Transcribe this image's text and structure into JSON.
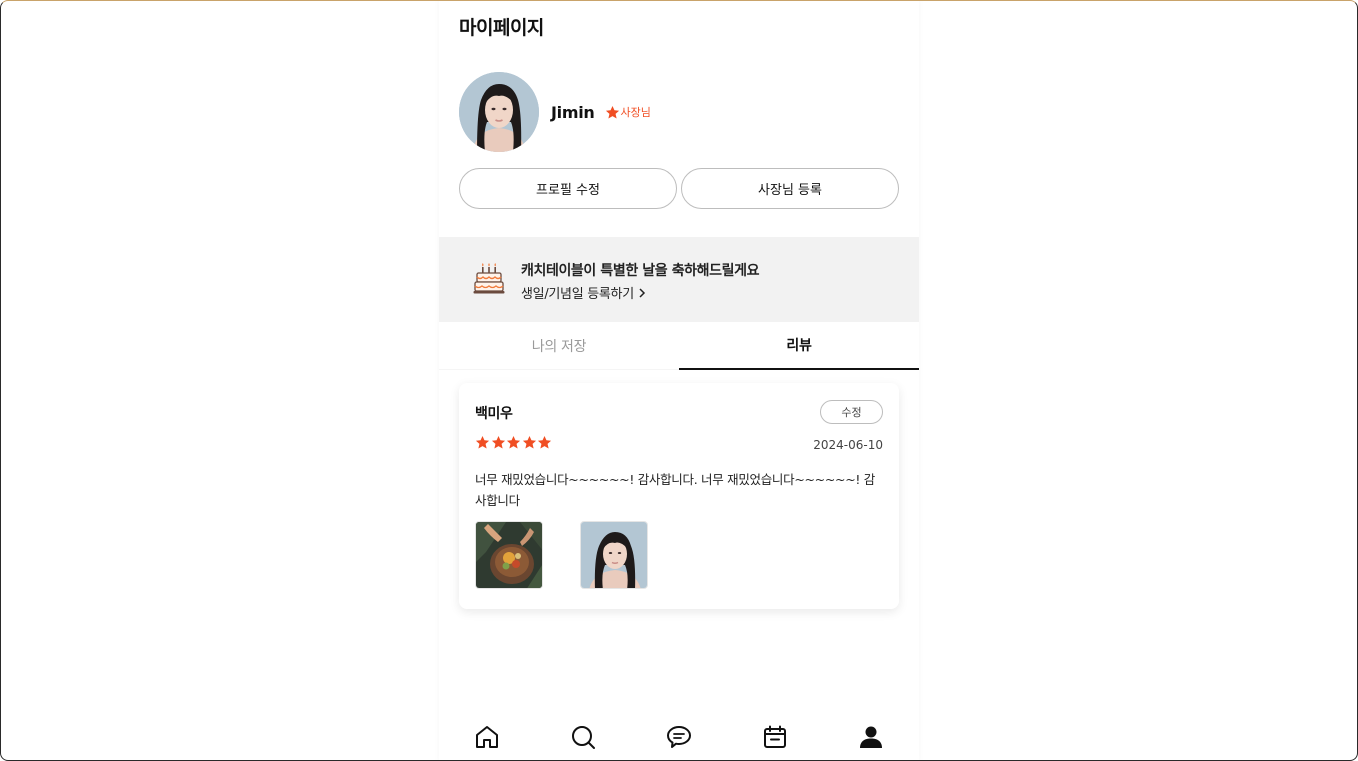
{
  "page_title": "마이페이지",
  "profile": {
    "name": "Jimin",
    "badge_label": "사장님",
    "badge_color": "#f04e23"
  },
  "buttons": {
    "edit_profile": "프로필 수정",
    "register_owner": "사장님 등록"
  },
  "banner": {
    "title": "캐치테이블이 특별한 날을 축하해드릴게요",
    "link": "생일/기념일 등록하기",
    "icon": "cake-icon"
  },
  "tabs": [
    {
      "label": "나의 저장",
      "active": false
    },
    {
      "label": "리뷰",
      "active": true
    }
  ],
  "review": {
    "reviewer": "백미우",
    "edit_label": "수정",
    "rating": 5,
    "date": "2024-06-10",
    "text": " 너무 재밌었습니다~~~~~~! 감사합니다.  너무 재밌었습니다~~~~~~! 감사합니다",
    "images": [
      "food-photo",
      "portrait-photo"
    ]
  },
  "bottom_nav": [
    {
      "icon": "home-icon"
    },
    {
      "icon": "search-icon"
    },
    {
      "icon": "chat-icon"
    },
    {
      "icon": "calendar-icon"
    },
    {
      "icon": "user-icon",
      "active": true
    }
  ],
  "colors": {
    "accent": "#f04e23",
    "banner_bg": "#f2f2f2"
  }
}
